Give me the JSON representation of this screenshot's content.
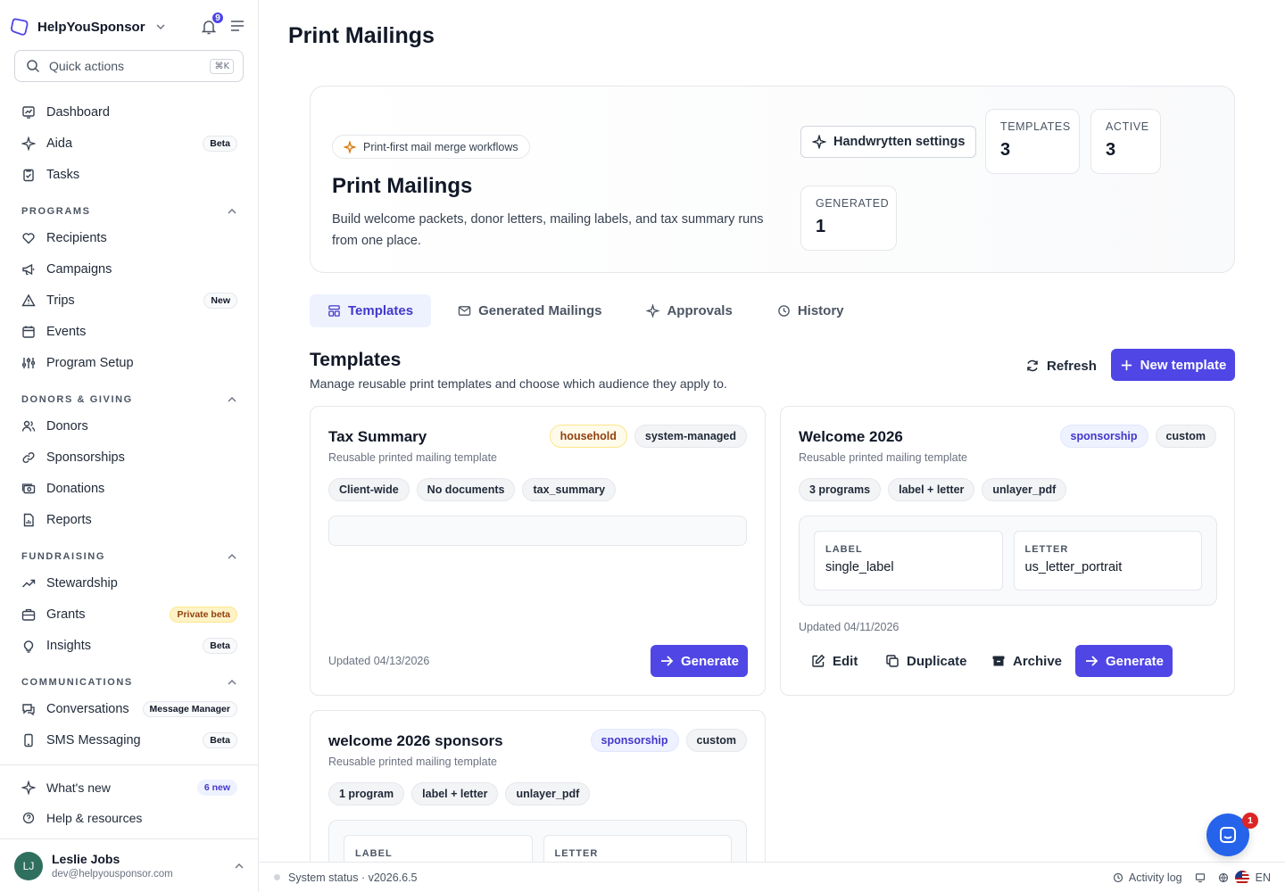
{
  "sidebar": {
    "brand": "HelpYouSponsor",
    "notifications_count": "9",
    "quick_actions": {
      "placeholder": "Quick actions",
      "shortcut": "⌘K"
    },
    "top_items": [
      {
        "label": "Dashboard",
        "icon": "dashboard-icon"
      },
      {
        "label": "Aida",
        "icon": "sparkle-icon",
        "badge": "Beta"
      },
      {
        "label": "Tasks",
        "icon": "clipboard-icon"
      }
    ],
    "sections": [
      {
        "title": "PROGRAMS",
        "items": [
          {
            "label": "Recipients",
            "icon": "heart-icon"
          },
          {
            "label": "Campaigns",
            "icon": "megaphone-icon"
          },
          {
            "label": "Trips",
            "icon": "warning-icon",
            "badge": "New"
          },
          {
            "label": "Events",
            "icon": "calendar-icon"
          },
          {
            "label": "Program Setup",
            "icon": "sliders-icon"
          }
        ]
      },
      {
        "title": "DONORS & GIVING",
        "items": [
          {
            "label": "Donors",
            "icon": "users-icon"
          },
          {
            "label": "Sponsorships",
            "icon": "link-icon"
          },
          {
            "label": "Donations",
            "icon": "cash-icon"
          },
          {
            "label": "Reports",
            "icon": "report-icon"
          }
        ]
      },
      {
        "title": "FUNDRAISING",
        "items": [
          {
            "label": "Stewardship",
            "icon": "trend-icon"
          },
          {
            "label": "Grants",
            "icon": "briefcase-icon",
            "badge": "Private beta"
          },
          {
            "label": "Insights",
            "icon": "lightbulb-icon",
            "badge": "Beta"
          }
        ]
      },
      {
        "title": "COMMUNICATIONS",
        "items": [
          {
            "label": "Conversations",
            "icon": "chat-icon",
            "badge": "Message Manager"
          },
          {
            "label": "SMS Messaging",
            "icon": "phone-icon",
            "badge": "Beta"
          }
        ]
      }
    ],
    "bottom_items": [
      {
        "label": "What's new",
        "icon": "sparkle-icon",
        "badge": "6 new"
      },
      {
        "label": "Help & resources",
        "icon": "help-icon"
      }
    ],
    "user": {
      "initials": "LJ",
      "name": "Leslie Jobs",
      "email": "dev@helpyousponsor.com"
    }
  },
  "page": {
    "title": "Print Mailings"
  },
  "hero": {
    "pill": "Print-first mail merge workflows",
    "title": "Print Mailings",
    "description": "Build welcome packets, donor letters, mailing labels, and tax summary runs from one place.",
    "settings_button": "Handwrytten settings",
    "stats": [
      {
        "label": "TEMPLATES",
        "value": "3"
      },
      {
        "label": "ACTIVE",
        "value": "3"
      },
      {
        "label": "GENERATED",
        "value": "1"
      }
    ]
  },
  "tabs": [
    {
      "label": "Templates",
      "active": true
    },
    {
      "label": "Generated Mailings"
    },
    {
      "label": "Approvals"
    },
    {
      "label": "History"
    }
  ],
  "templates_section": {
    "title": "Templates",
    "subtitle": "Manage reusable print templates and choose which audience they apply to.",
    "refresh": "Refresh",
    "new_template": "New template"
  },
  "cards": [
    {
      "title": "Tax Summary",
      "subtitle": "Reusable printed mailing template",
      "badges": [
        "household",
        "system-managed"
      ],
      "tags": [
        "Client-wide",
        "No documents",
        "tax_summary"
      ],
      "updated": "Updated 04/13/2026",
      "generate": "Generate"
    },
    {
      "title": "Welcome 2026",
      "subtitle": "Reusable printed mailing template",
      "badges": [
        "sponsorship",
        "custom"
      ],
      "tags": [
        "3 programs",
        "label + letter",
        "unlayer_pdf"
      ],
      "formats": [
        {
          "label": "LABEL",
          "value": "single_label"
        },
        {
          "label": "LETTER",
          "value": "us_letter_portrait"
        }
      ],
      "updated": "Updated 04/11/2026",
      "actions": {
        "edit": "Edit",
        "duplicate": "Duplicate",
        "archive": "Archive",
        "generate": "Generate"
      }
    },
    {
      "title": "welcome 2026 sponsors",
      "subtitle": "Reusable printed mailing template",
      "badges": [
        "sponsorship",
        "custom"
      ],
      "tags": [
        "1 program",
        "label + letter",
        "unlayer_pdf"
      ],
      "formats": [
        {
          "label": "LABEL",
          "value": ""
        },
        {
          "label": "LETTER",
          "value": ""
        }
      ]
    }
  ],
  "statusbar": {
    "status": "System status · v2026.6.5",
    "activity": "Activity log",
    "language": "EN"
  },
  "chat": {
    "badge": "1"
  },
  "colors": {
    "accent": "#4f46e5",
    "accent_soft": "#eef2ff",
    "border": "#e5e7eb"
  }
}
